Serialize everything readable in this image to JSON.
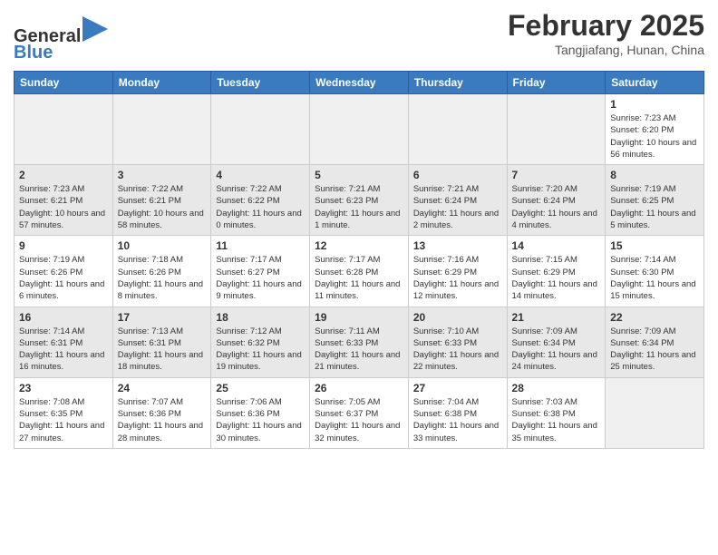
{
  "header": {
    "logo_general": "General",
    "logo_blue": "Blue",
    "month_title": "February 2025",
    "location": "Tangjiafang, Hunan, China"
  },
  "days_of_week": [
    "Sunday",
    "Monday",
    "Tuesday",
    "Wednesday",
    "Thursday",
    "Friday",
    "Saturday"
  ],
  "weeks": [
    [
      {
        "day": "",
        "empty": true
      },
      {
        "day": "",
        "empty": true
      },
      {
        "day": "",
        "empty": true
      },
      {
        "day": "",
        "empty": true
      },
      {
        "day": "",
        "empty": true
      },
      {
        "day": "",
        "empty": true
      },
      {
        "day": "1",
        "sunrise": "Sunrise: 7:23 AM",
        "sunset": "Sunset: 6:20 PM",
        "daylight": "Daylight: 10 hours and 56 minutes."
      }
    ],
    [
      {
        "day": "2",
        "sunrise": "Sunrise: 7:23 AM",
        "sunset": "Sunset: 6:21 PM",
        "daylight": "Daylight: 10 hours and 57 minutes."
      },
      {
        "day": "3",
        "sunrise": "Sunrise: 7:22 AM",
        "sunset": "Sunset: 6:21 PM",
        "daylight": "Daylight: 10 hours and 58 minutes."
      },
      {
        "day": "4",
        "sunrise": "Sunrise: 7:22 AM",
        "sunset": "Sunset: 6:22 PM",
        "daylight": "Daylight: 11 hours and 0 minutes."
      },
      {
        "day": "5",
        "sunrise": "Sunrise: 7:21 AM",
        "sunset": "Sunset: 6:23 PM",
        "daylight": "Daylight: 11 hours and 1 minute."
      },
      {
        "day": "6",
        "sunrise": "Sunrise: 7:21 AM",
        "sunset": "Sunset: 6:24 PM",
        "daylight": "Daylight: 11 hours and 2 minutes."
      },
      {
        "day": "7",
        "sunrise": "Sunrise: 7:20 AM",
        "sunset": "Sunset: 6:24 PM",
        "daylight": "Daylight: 11 hours and 4 minutes."
      },
      {
        "day": "8",
        "sunrise": "Sunrise: 7:19 AM",
        "sunset": "Sunset: 6:25 PM",
        "daylight": "Daylight: 11 hours and 5 minutes."
      }
    ],
    [
      {
        "day": "9",
        "sunrise": "Sunrise: 7:19 AM",
        "sunset": "Sunset: 6:26 PM",
        "daylight": "Daylight: 11 hours and 6 minutes."
      },
      {
        "day": "10",
        "sunrise": "Sunrise: 7:18 AM",
        "sunset": "Sunset: 6:26 PM",
        "daylight": "Daylight: 11 hours and 8 minutes."
      },
      {
        "day": "11",
        "sunrise": "Sunrise: 7:17 AM",
        "sunset": "Sunset: 6:27 PM",
        "daylight": "Daylight: 11 hours and 9 minutes."
      },
      {
        "day": "12",
        "sunrise": "Sunrise: 7:17 AM",
        "sunset": "Sunset: 6:28 PM",
        "daylight": "Daylight: 11 hours and 11 minutes."
      },
      {
        "day": "13",
        "sunrise": "Sunrise: 7:16 AM",
        "sunset": "Sunset: 6:29 PM",
        "daylight": "Daylight: 11 hours and 12 minutes."
      },
      {
        "day": "14",
        "sunrise": "Sunrise: 7:15 AM",
        "sunset": "Sunset: 6:29 PM",
        "daylight": "Daylight: 11 hours and 14 minutes."
      },
      {
        "day": "15",
        "sunrise": "Sunrise: 7:14 AM",
        "sunset": "Sunset: 6:30 PM",
        "daylight": "Daylight: 11 hours and 15 minutes."
      }
    ],
    [
      {
        "day": "16",
        "sunrise": "Sunrise: 7:14 AM",
        "sunset": "Sunset: 6:31 PM",
        "daylight": "Daylight: 11 hours and 16 minutes."
      },
      {
        "day": "17",
        "sunrise": "Sunrise: 7:13 AM",
        "sunset": "Sunset: 6:31 PM",
        "daylight": "Daylight: 11 hours and 18 minutes."
      },
      {
        "day": "18",
        "sunrise": "Sunrise: 7:12 AM",
        "sunset": "Sunset: 6:32 PM",
        "daylight": "Daylight: 11 hours and 19 minutes."
      },
      {
        "day": "19",
        "sunrise": "Sunrise: 7:11 AM",
        "sunset": "Sunset: 6:33 PM",
        "daylight": "Daylight: 11 hours and 21 minutes."
      },
      {
        "day": "20",
        "sunrise": "Sunrise: 7:10 AM",
        "sunset": "Sunset: 6:33 PM",
        "daylight": "Daylight: 11 hours and 22 minutes."
      },
      {
        "day": "21",
        "sunrise": "Sunrise: 7:09 AM",
        "sunset": "Sunset: 6:34 PM",
        "daylight": "Daylight: 11 hours and 24 minutes."
      },
      {
        "day": "22",
        "sunrise": "Sunrise: 7:09 AM",
        "sunset": "Sunset: 6:34 PM",
        "daylight": "Daylight: 11 hours and 25 minutes."
      }
    ],
    [
      {
        "day": "23",
        "sunrise": "Sunrise: 7:08 AM",
        "sunset": "Sunset: 6:35 PM",
        "daylight": "Daylight: 11 hours and 27 minutes."
      },
      {
        "day": "24",
        "sunrise": "Sunrise: 7:07 AM",
        "sunset": "Sunset: 6:36 PM",
        "daylight": "Daylight: 11 hours and 28 minutes."
      },
      {
        "day": "25",
        "sunrise": "Sunrise: 7:06 AM",
        "sunset": "Sunset: 6:36 PM",
        "daylight": "Daylight: 11 hours and 30 minutes."
      },
      {
        "day": "26",
        "sunrise": "Sunrise: 7:05 AM",
        "sunset": "Sunset: 6:37 PM",
        "daylight": "Daylight: 11 hours and 32 minutes."
      },
      {
        "day": "27",
        "sunrise": "Sunrise: 7:04 AM",
        "sunset": "Sunset: 6:38 PM",
        "daylight": "Daylight: 11 hours and 33 minutes."
      },
      {
        "day": "28",
        "sunrise": "Sunrise: 7:03 AM",
        "sunset": "Sunset: 6:38 PM",
        "daylight": "Daylight: 11 hours and 35 minutes."
      },
      {
        "day": "",
        "empty": true
      }
    ]
  ]
}
